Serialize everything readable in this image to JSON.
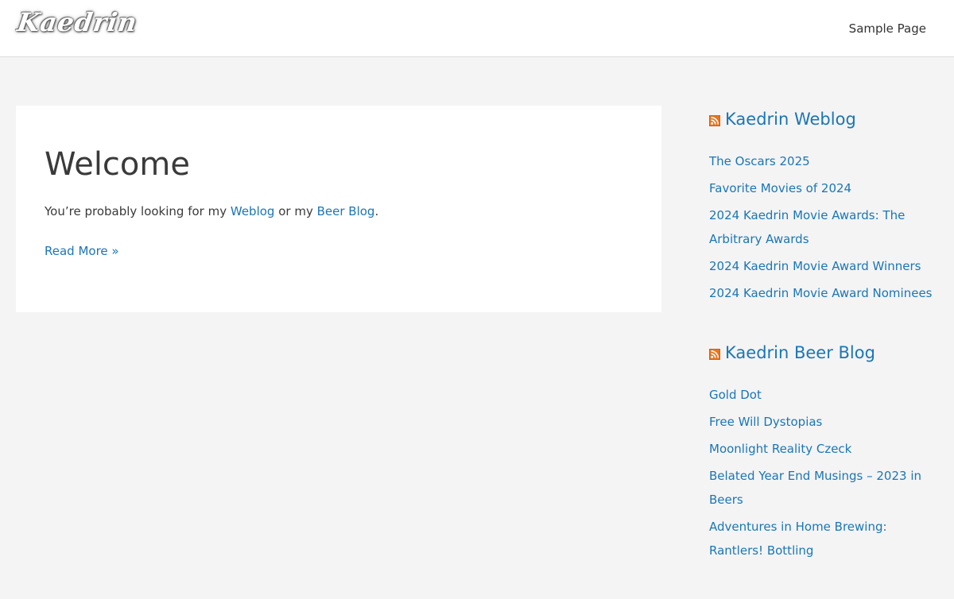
{
  "header": {
    "logo_text": "Kaedrin",
    "nav": {
      "sample_page": "Sample Page"
    }
  },
  "article": {
    "title": "Welcome",
    "excerpt": {
      "prefix": "You’re probably looking for my ",
      "link1": "Weblog",
      "middle": " or my ",
      "link2": "Beer Blog",
      "suffix": "."
    },
    "read_more": "Read More »"
  },
  "sidebar": {
    "weblog": {
      "title": "Kaedrin Weblog",
      "items": [
        "The Oscars 2025",
        "Favorite Movies of 2024",
        "2024 Kaedrin Movie Awards: The Arbitrary Awards",
        "2024 Kaedrin Movie Award Winners",
        "2024 Kaedrin Movie Award Nominees"
      ]
    },
    "beer": {
      "title": "Kaedrin Beer Blog",
      "items": [
        "Gold Dot",
        "Free Will Dystopias",
        "Moonlight Reality Czeck",
        "Belated Year End Musings – 2023 in Beers",
        "Adventures in Home Brewing: Rantlers! Bottling"
      ]
    }
  },
  "colors": {
    "link": "#1b76b5",
    "background": "#f4f4f4",
    "rss": "#f26522"
  },
  "icons": {
    "feed": "rss-icon"
  }
}
